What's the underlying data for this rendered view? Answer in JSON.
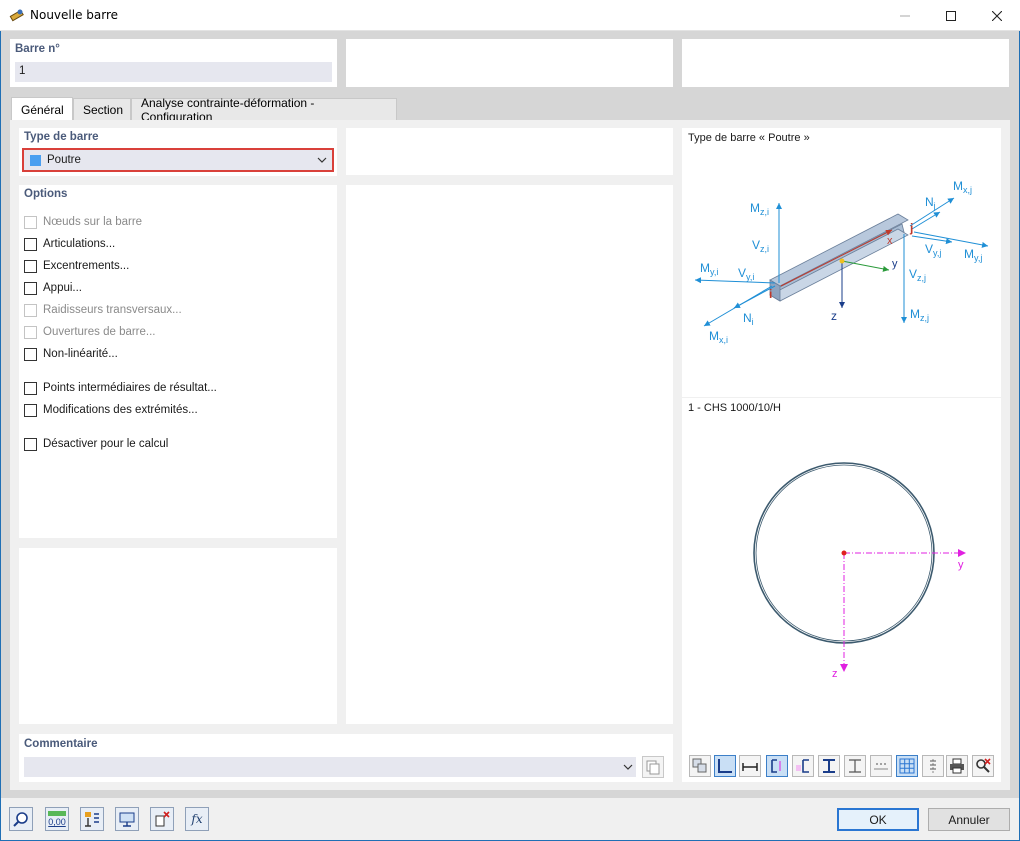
{
  "window": {
    "title": "Nouvelle barre",
    "minimize_icon": "minimize-icon",
    "maximize_icon": "maximize-icon",
    "close_icon": "close-icon"
  },
  "member_no": {
    "label": "Barre n°",
    "value": "1"
  },
  "tabs": [
    {
      "label": "Général",
      "active": true
    },
    {
      "label": "Section",
      "active": false
    },
    {
      "label": "Analyse contrainte-déformation - Configuration",
      "active": false
    }
  ],
  "member_type": {
    "label": "Type de barre",
    "value": "Poutre",
    "swatch_color": "#4a9ff0",
    "highlight_color": "#d9403a"
  },
  "options": {
    "label": "Options",
    "items": [
      {
        "label": "Nœuds sur la barre",
        "enabled": false,
        "checked": false
      },
      {
        "label": "Articulations...",
        "enabled": true,
        "checked": false
      },
      {
        "label": "Excentrements...",
        "enabled": true,
        "checked": false
      },
      {
        "label": "Appui...",
        "enabled": true,
        "checked": false
      },
      {
        "label": "Raidisseurs transversaux...",
        "enabled": false,
        "checked": false
      },
      {
        "label": "Ouvertures de barre...",
        "enabled": false,
        "checked": false
      },
      {
        "label": "Non-linéarité...",
        "enabled": true,
        "checked": false
      },
      {
        "label": "Points intermédiaires de résultat...",
        "enabled": true,
        "checked": false
      },
      {
        "label": "Modifications des extrémités...",
        "enabled": true,
        "checked": false
      },
      {
        "label": "Désactiver pour le calcul",
        "enabled": true,
        "checked": false
      }
    ]
  },
  "comment": {
    "label": "Commentaire",
    "value": ""
  },
  "diagram": {
    "title": "Type de barre « Poutre »",
    "labels": {
      "mzi": "M",
      "mzi_sub": "z,i",
      "vzi": "V",
      "vzi_sub": "z,i",
      "myi": "M",
      "myi_sub": "y,i",
      "vyi": "V",
      "vyi_sub": "y,i",
      "ni": "N",
      "ni_sub": "i",
      "mxi": "M",
      "mxi_sub": "x,i",
      "nj": "N",
      "nj_sub": "j",
      "mxj": "M",
      "mxj_sub": "x,j",
      "vyj": "V",
      "vyj_sub": "y,j",
      "myj": "M",
      "myj_sub": "y,j",
      "vzj": "V",
      "vzj_sub": "z,j",
      "mzj": "M",
      "mzj_sub": "z,j",
      "i": "i",
      "j": "j",
      "x": "x",
      "y": "y",
      "z": "z"
    },
    "force_color": "#1f8fd6",
    "axis_z_color": "#1a3d8a"
  },
  "section": {
    "title": "1 - CHS 1000/10/H",
    "axis_y": "y",
    "axis_z": "z",
    "axis_color": "#e020e0",
    "outline_color": "#3c5a6e"
  },
  "section_toolbar": [
    {
      "icon": "copy-section-icon",
      "active": false
    },
    {
      "icon": "dimension-corner-icon",
      "active": true
    },
    {
      "icon": "dimension-width-icon",
      "active": false
    },
    {
      "icon": "dimension-axis-icon",
      "active": true
    },
    {
      "icon": "section-properties-icon",
      "active": false
    },
    {
      "icon": "ibeam-icon",
      "active": false
    },
    {
      "icon": "ibeam-outline-icon",
      "active": false
    },
    {
      "icon": "dim-points-icon",
      "active": false
    },
    {
      "icon": "grid-icon",
      "active": true
    },
    {
      "icon": "stress-points-icon",
      "active": false
    },
    {
      "icon": "print-icon",
      "active": false
    },
    {
      "icon": "reset-view-icon",
      "active": false
    }
  ],
  "footer": {
    "tool_icons": [
      "search-help-icon",
      "units-icon",
      "member-info-icon",
      "display-settings-icon",
      "delete-nodes-icon",
      "formula-icon"
    ],
    "units_text": "0,00",
    "formula_text": "fx",
    "ok_label": "OK",
    "cancel_label": "Annuler"
  }
}
